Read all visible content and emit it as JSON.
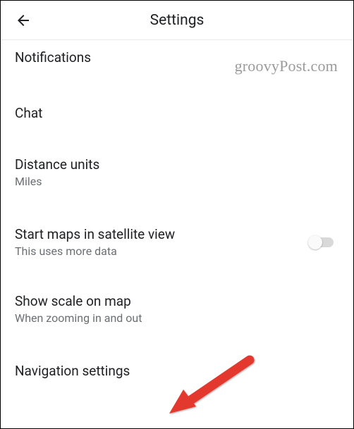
{
  "header": {
    "title": "Settings"
  },
  "watermark": "groovyPost.com",
  "rows": {
    "notifications": {
      "title": "Notifications"
    },
    "chat": {
      "title": "Chat"
    },
    "distance": {
      "title": "Distance units",
      "sub": "Miles"
    },
    "satellite": {
      "title": "Start maps in satellite view",
      "sub": "This uses more data",
      "toggle": false
    },
    "scale": {
      "title": "Show scale on map",
      "sub": "When zooming in and out"
    },
    "navigation": {
      "title": "Navigation settings"
    }
  }
}
